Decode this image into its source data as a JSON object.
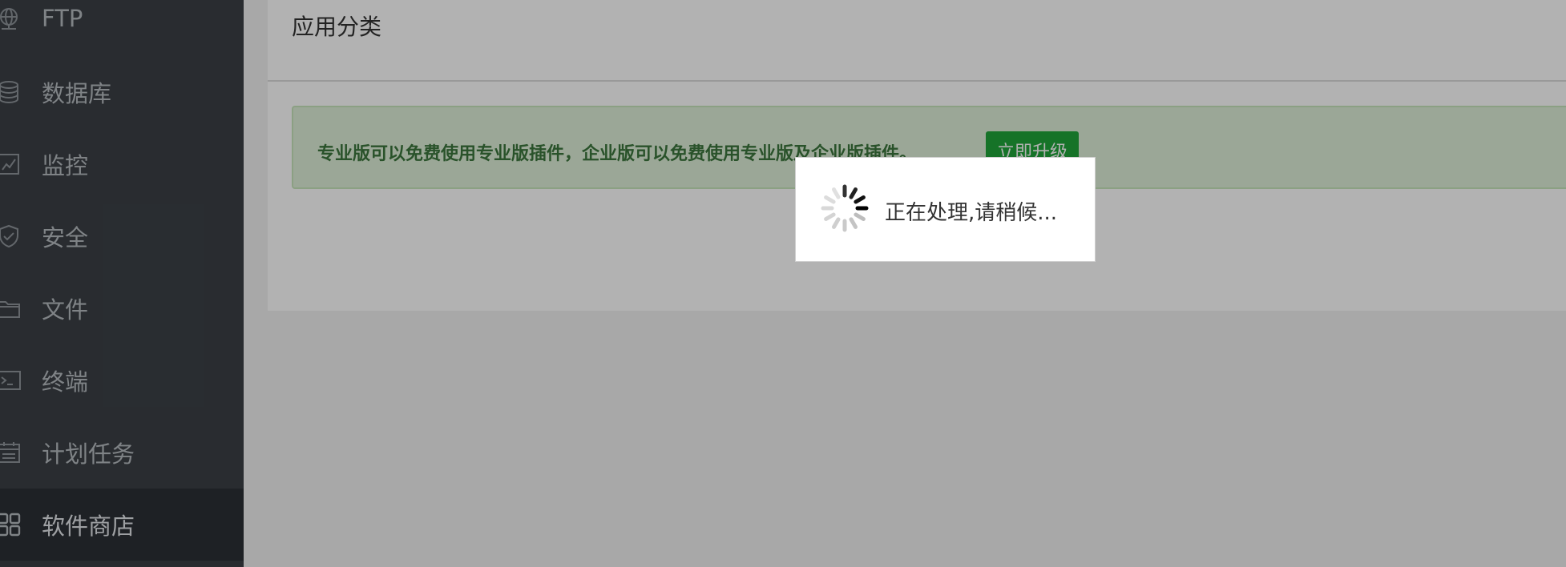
{
  "sidebar": {
    "items": [
      {
        "label": "FTP",
        "icon": "ftp-icon"
      },
      {
        "label": "数据库",
        "icon": "database-icon"
      },
      {
        "label": "监控",
        "icon": "monitor-icon"
      },
      {
        "label": "安全",
        "icon": "shield-icon"
      },
      {
        "label": "文件",
        "icon": "folder-icon"
      },
      {
        "label": "终端",
        "icon": "terminal-icon"
      },
      {
        "label": "计划任务",
        "icon": "calendar-icon"
      },
      {
        "label": "软件商店",
        "icon": "app-grid-icon",
        "active": true
      }
    ]
  },
  "main": {
    "title": "应用分类",
    "notice": {
      "text": "专业版可以免费使用专业版插件，企业版可以免费使用专业版及企业版插件。",
      "button": "立即升级"
    }
  },
  "loading": {
    "text": "正在处理,请稍候..."
  },
  "colors": {
    "sidebar_bg": "#3b4046",
    "sidebar_active_bg": "#2c3035",
    "notice_bg": "#dff0d8",
    "notice_text": "#3c763d",
    "accent": "#20a53a"
  }
}
